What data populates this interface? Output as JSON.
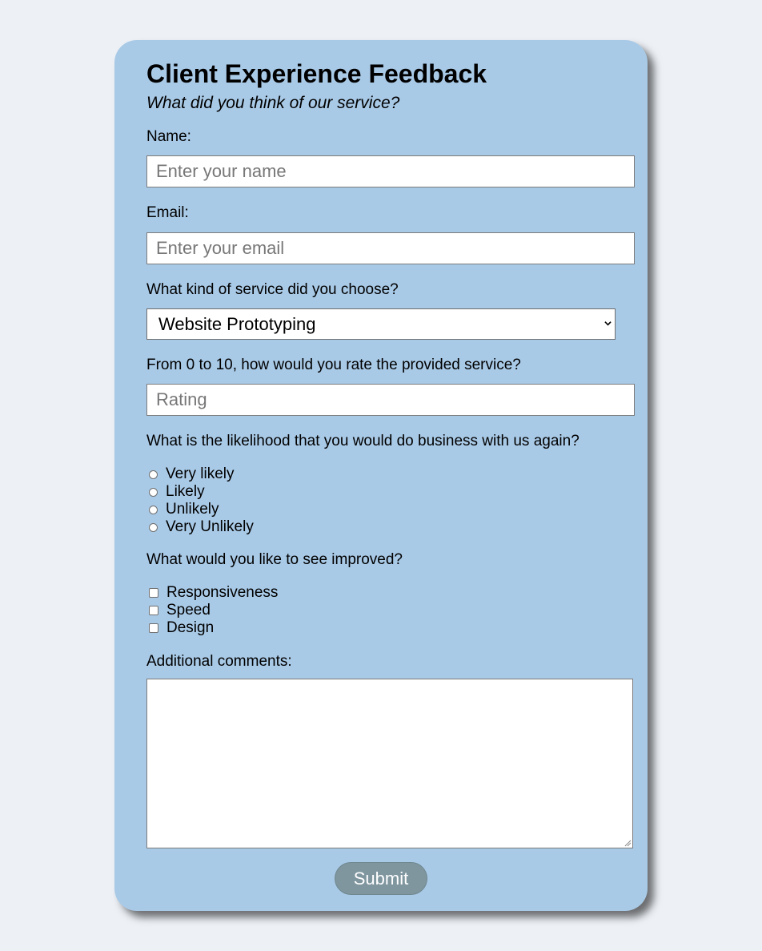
{
  "form": {
    "title": "Client Experience Feedback",
    "subtitle": "What did you think of our service?",
    "name_label": "Name:",
    "name_placeholder": "Enter your name",
    "email_label": "Email:",
    "email_placeholder": "Enter your email",
    "service_label": "What kind of service did you choose?",
    "service_selected": "Website Prototyping",
    "rating_label": "From 0 to 10, how would you rate the provided service?",
    "rating_placeholder": "Rating",
    "likelihood_label": "What is the likelihood that you would do business with us again?",
    "likelihood_options": [
      "Very likely",
      "Likely",
      "Unlikely",
      "Very Unlikely"
    ],
    "improve_label": "What would you like to see improved?",
    "improve_options": [
      "Responsiveness",
      "Speed",
      "Design"
    ],
    "comments_label": "Additional comments:",
    "comments_value": "",
    "submit_label": "Submit"
  },
  "colors": {
    "page_background": "#edf1f6",
    "card_background": "#a9cae7",
    "submit_background": "#7f969f"
  }
}
